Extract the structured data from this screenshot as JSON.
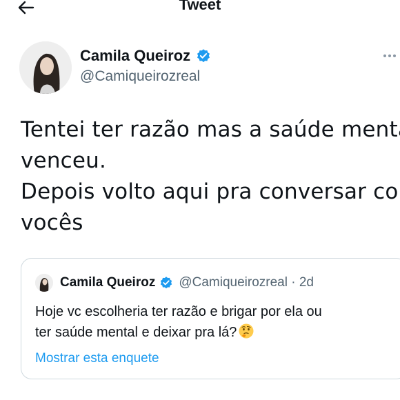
{
  "header": {
    "title": "Tweet",
    "back_icon": "arrow-left-icon"
  },
  "tweet": {
    "author_name": "Camila Queiroz",
    "author_handle": "@Camiqueirozreal",
    "verified": true,
    "text_lines": [
      "Tentei ter razão mas a saúde mental",
      "venceu.",
      "Depois volto aqui pra conversar com",
      "vocês"
    ]
  },
  "quote": {
    "author_name": "Camila Queiroz",
    "author_handle": "@Camiqueirozreal · 2d",
    "text_lines": [
      "Hoje vc escolheria ter razão e brigar por ela ou",
      "ter saúde mental e deixar pra lá?"
    ],
    "emoji": "thinking-face-icon",
    "poll_link": "Mostrar esta enquete"
  },
  "colors": {
    "text": "#0f1419",
    "secondary": "#536471",
    "link": "#1d9bf0",
    "border": "#cfd9de",
    "verified": "#1d9bf0"
  }
}
